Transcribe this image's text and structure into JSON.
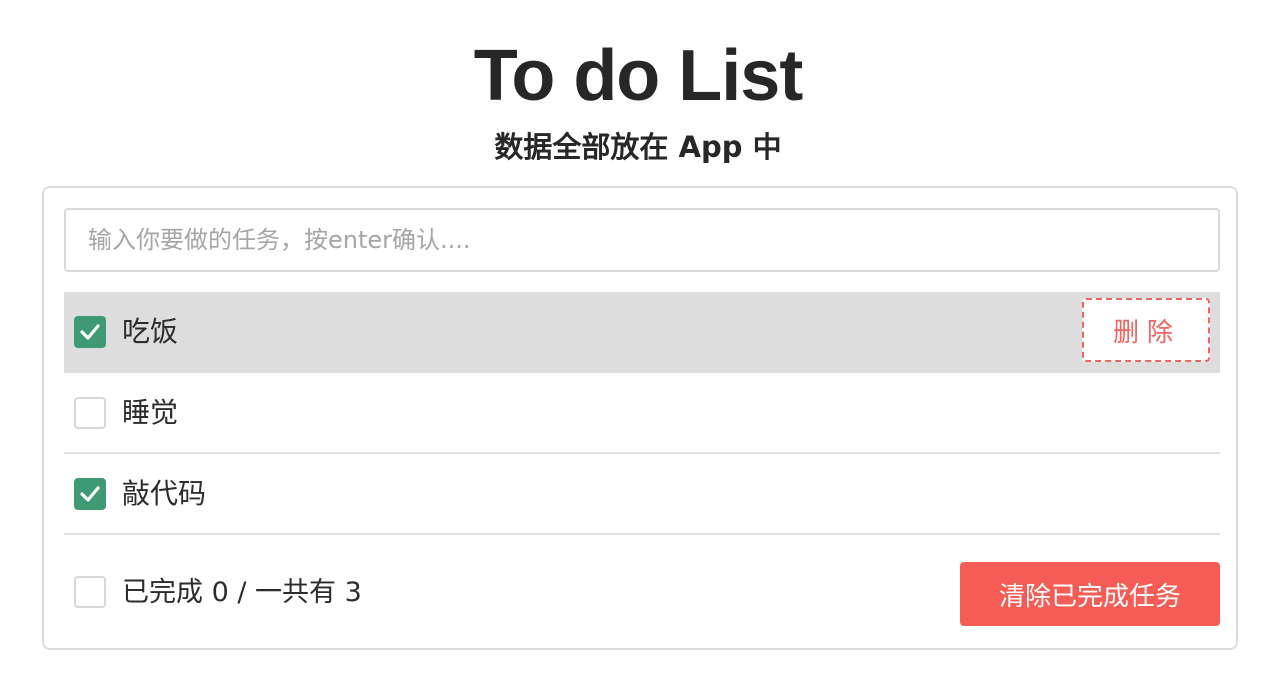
{
  "header": {
    "title": "To do List",
    "subtitle": "数据全部放在 App 中"
  },
  "input": {
    "placeholder": "输入你要做的任务，按enter确认....",
    "value": ""
  },
  "todos": [
    {
      "label": "吃饭",
      "done": true,
      "hovered": true,
      "delete_label": "删除"
    },
    {
      "label": "睡觉",
      "done": false,
      "hovered": false
    },
    {
      "label": "敲代码",
      "done": true,
      "hovered": false
    }
  ],
  "footer": {
    "select_all_checked": false,
    "summary": "已完成 0 / 一共有 3",
    "clear_button_label": "清除已完成任务"
  },
  "colors": {
    "checked": "#3e9a72",
    "danger": "#f45c55",
    "row_hover": "#dddddd"
  },
  "icons": {
    "checkmark": "checkmark-icon"
  }
}
